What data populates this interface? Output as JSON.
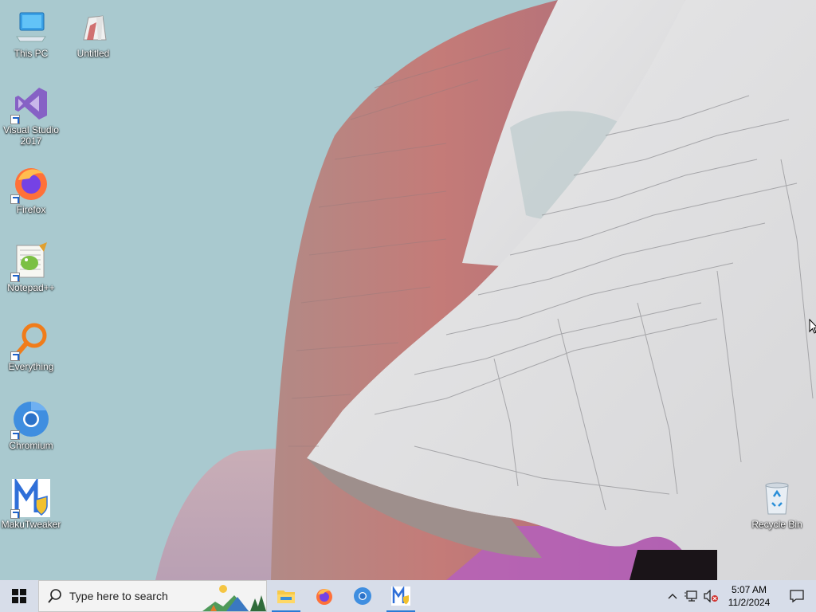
{
  "desktop": {
    "icons": [
      {
        "label": "This PC"
      },
      {
        "label": "Untitled"
      },
      {
        "label": "Visual Studio\n2017"
      },
      {
        "label": "Firefox"
      },
      {
        "label": "Notepad++"
      },
      {
        "label": "Everything"
      },
      {
        "label": "Chromium"
      },
      {
        "label": "MakuTweaker"
      },
      {
        "label": "Recycle Bin"
      }
    ]
  },
  "taskbar": {
    "search_placeholder": "Type here to search",
    "pinned": [
      "file-explorer-icon",
      "firefox-icon",
      "chromium-icon",
      "makutweaker-icon"
    ],
    "clock": {
      "time": "5:07 AM",
      "date": "11/2/2024"
    }
  },
  "colors": {
    "taskbar_bg": "#d7dde9",
    "sky": "#a9c9cf",
    "accent": "#2a7bd6"
  }
}
